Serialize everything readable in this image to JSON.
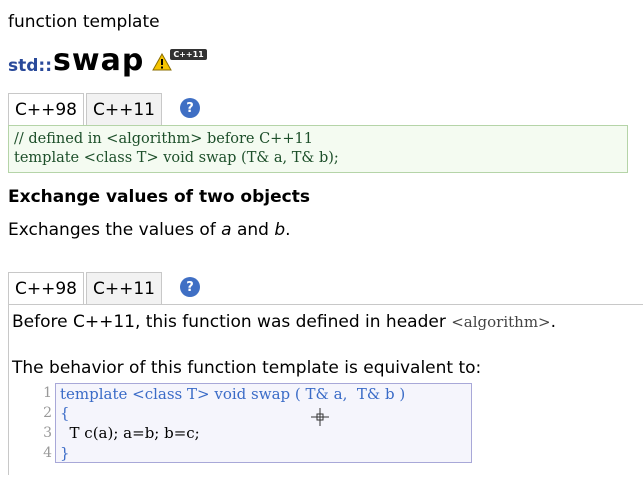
{
  "header": {
    "kind": "function template",
    "namespace": "std::",
    "name": "swap",
    "badge": "C++11"
  },
  "tabs_top": [
    {
      "label": "C++98",
      "active": true
    },
    {
      "label": "C++11",
      "active": false
    }
  ],
  "help_icon": "?",
  "declaration": {
    "line1": "// defined in <algorithm> before C++11",
    "line2": "template <class T> void swap (T& a, T& b);"
  },
  "summary": {
    "heading": "Exchange values of two objects",
    "text_pre": "Exchanges the values of ",
    "param_a": "a",
    "text_mid": " and ",
    "param_b": "b",
    "text_post": "."
  },
  "tabs_bottom": [
    {
      "label": "C++98",
      "active": true
    },
    {
      "label": "C++11",
      "active": false
    }
  ],
  "body": {
    "note_pre": "Before C++11, this function was defined in header ",
    "note_header": "<algorithm>",
    "note_post": ".",
    "equivalent": "The behavior of this function template is equivalent to:"
  },
  "code": {
    "lines": [
      {
        "num": "1",
        "text": "template <class T> void swap ( T& a,  T& b )"
      },
      {
        "num": "2",
        "text": "{"
      },
      {
        "num": "3",
        "text": "  T c(a); a=b; b=c;"
      },
      {
        "num": "4",
        "text": "}"
      }
    ]
  },
  "colors": {
    "namespace": "#2a4a9a",
    "declaration_text": "#1d4f2a",
    "declaration_bg": "#f4fbf1",
    "code_bg": "#f5f5fc",
    "help_icon": "#3f6fc4"
  },
  "icons": [
    "warning-icon",
    "help-icon",
    "crosshair-cursor-icon"
  ]
}
